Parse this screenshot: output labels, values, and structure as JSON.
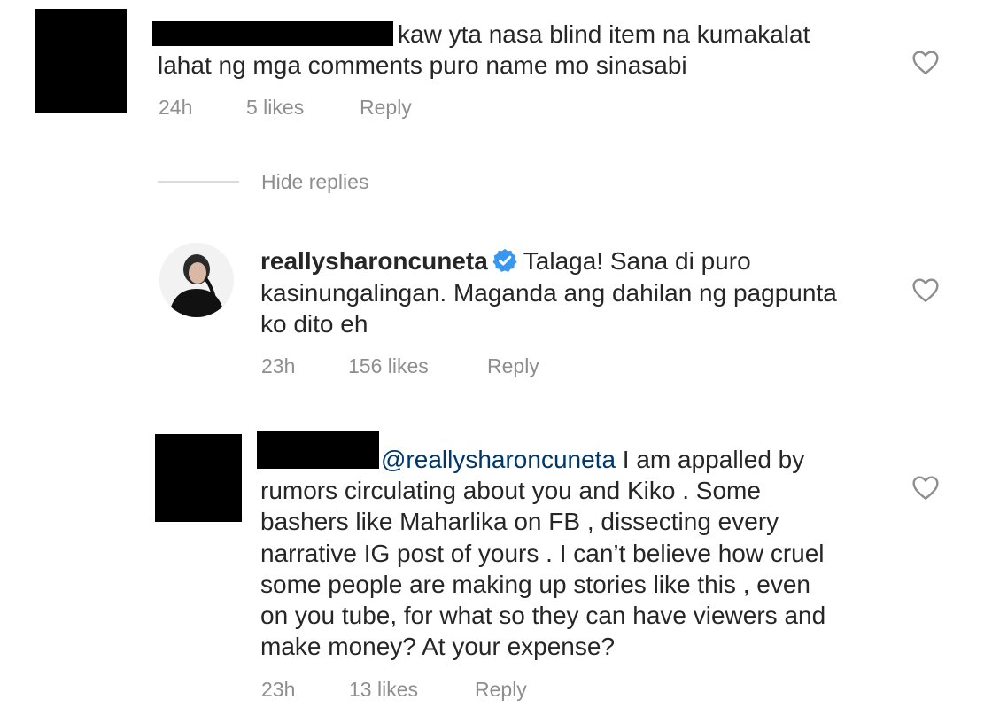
{
  "comment1": {
    "text_line1": "kaw yta nasa blind item na kumakalat",
    "text_line2": "lahat ng mga comments puro name mo sinasabi",
    "time": "24h",
    "likes": "5 likes",
    "reply": "Reply"
  },
  "hide_replies": "Hide replies",
  "reply1": {
    "username": "reallysharoncuneta",
    "text_line1": "Talaga! Sana di puro",
    "text_line2": "kasinungalingan. Maganda ang dahilan ng pagpunta",
    "text_line3": "ko dito eh",
    "time": "23h",
    "likes": "156 likes",
    "reply": "Reply"
  },
  "reply2": {
    "mention": "@reallysharoncuneta",
    "text_line1": "I am appalled by",
    "text_line2": "rumors circulating about you and Kiko . Some",
    "text_line3": "bashers like Maharlika on FB , dissecting every",
    "text_line4": "narrative IG post of yours . I can’t believe how cruel",
    "text_line5": "some people are making up stories like this , even",
    "text_line6": "on you tube, for what so they can have viewers and",
    "text_line7": "make money? At your expense?",
    "time": "23h",
    "likes": "13 likes",
    "reply": "Reply"
  },
  "icons": {
    "like": "heart-outline-icon",
    "verified": "verified-badge-icon"
  },
  "colors": {
    "text": "#262626",
    "meta": "#8e8e8e",
    "mention": "#00376b",
    "verified": "#3897f0"
  }
}
